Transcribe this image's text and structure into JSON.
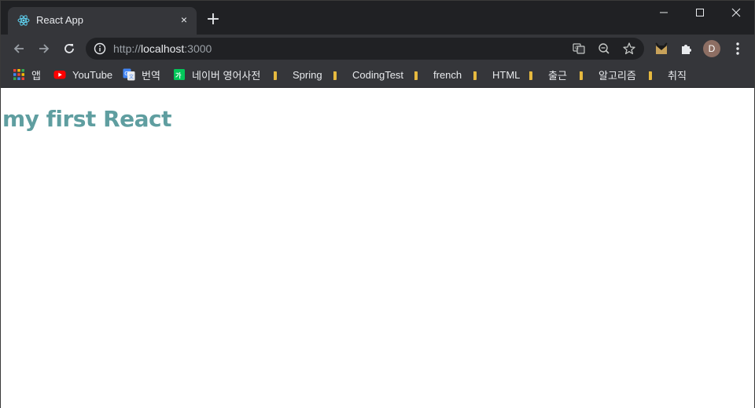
{
  "tab": {
    "title": "React App",
    "close_glyph": "×",
    "favicon": "react-icon"
  },
  "newtab": {
    "glyph": "+"
  },
  "window_controls": {
    "minimize": "minimize-icon",
    "maximize": "maximize-icon",
    "close": "close-icon"
  },
  "address": {
    "scheme": "http://",
    "host": "localhost",
    "port": ":3000"
  },
  "profile": {
    "initial": "D"
  },
  "bookmarks": [
    {
      "label": "앱",
      "icon": "apps-grid-icon"
    },
    {
      "label": "YouTube",
      "icon": "youtube-icon"
    },
    {
      "label": "번역",
      "icon": "translate-icon"
    },
    {
      "label": "네이버 영어사전",
      "icon": "naver-dictionary-icon"
    },
    {
      "label": "Spring",
      "icon": "folder-icon"
    },
    {
      "label": "CodingTest",
      "icon": "folder-icon"
    },
    {
      "label": "french",
      "icon": "folder-icon"
    },
    {
      "label": "HTML",
      "icon": "folder-icon"
    },
    {
      "label": "출근",
      "icon": "folder-icon"
    },
    {
      "label": "알고리즘",
      "icon": "folder-icon"
    },
    {
      "label": "취직",
      "icon": "folder-icon"
    }
  ],
  "page": {
    "heading": "my first React"
  },
  "colors": {
    "heading": "#5f9ea0",
    "chrome_dark": "#202124",
    "chrome_toolbar": "#35363a",
    "avatar": "#8d6e63"
  }
}
